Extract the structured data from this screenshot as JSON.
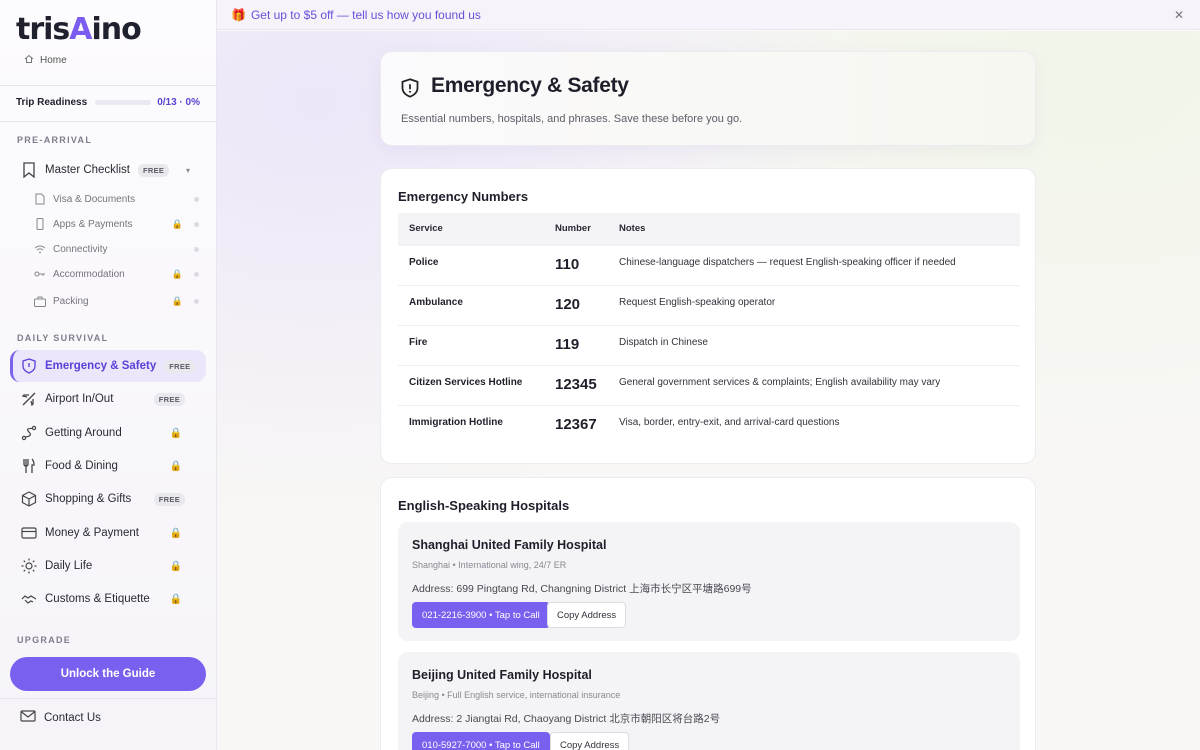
{
  "brand": {
    "logo_left": "tris",
    "logo_accent": "A",
    "logo_right": "ino"
  },
  "sidebar": {
    "home_label": "Home",
    "readiness": {
      "label": "Trip Readiness",
      "value": "0/13 · 0%",
      "progress": 0
    },
    "sections": {
      "pre_arrival": "PRE-ARRIVAL",
      "daily_survival": "DAILY SURVIVAL",
      "upgrade": "UPGRADE"
    },
    "master_checklist": {
      "label": "Master Checklist",
      "badge": "FREE"
    },
    "checklist_items": [
      {
        "label": "Visa & Documents",
        "icon": "document-icon",
        "locked": false
      },
      {
        "label": "Apps & Payments",
        "icon": "phone-icon",
        "locked": true
      },
      {
        "label": "Connectivity",
        "icon": "wifi-icon",
        "locked": false
      },
      {
        "label": "Accommodation",
        "icon": "key-icon",
        "locked": true
      },
      {
        "label": "Packing",
        "icon": "suitcase-icon",
        "locked": true
      }
    ],
    "nav_items": [
      {
        "label": "Emergency & Safety",
        "badge": "FREE",
        "icon": "shield-icon",
        "active": true
      },
      {
        "label": "Airport In/Out",
        "badge": "FREE",
        "icon": "plane-icon"
      },
      {
        "label": "Getting Around",
        "badge": "",
        "icon": "route-icon",
        "locked": true
      },
      {
        "label": "Food & Dining",
        "badge": "",
        "icon": "utensils-icon",
        "locked": true
      },
      {
        "label": "Shopping & Gifts",
        "badge": "FREE",
        "icon": "box-icon"
      },
      {
        "label": "Money & Payment",
        "badge": "",
        "icon": "card-icon",
        "locked": true
      },
      {
        "label": "Daily Life",
        "badge": "",
        "icon": "sun-icon",
        "locked": true
      },
      {
        "label": "Customs & Etiquette",
        "badge": "",
        "icon": "handshake-icon",
        "locked": true
      }
    ],
    "unlock_label": "Unlock the Guide",
    "contact_label": "Contact Us"
  },
  "promo": {
    "text": "Get up to $5 off — tell us how you found us",
    "close": "✕"
  },
  "page": {
    "title": "Emergency & Safety",
    "subtitle": "Essential numbers, hospitals, and phrases. Save these before you go."
  },
  "emergency_numbers": {
    "heading": "Emergency Numbers",
    "columns": [
      "Service",
      "Number",
      "Notes"
    ],
    "rows": [
      {
        "service": "Police",
        "number": "110",
        "notes": "Chinese-language dispatchers — request English-speaking officer if needed"
      },
      {
        "service": "Ambulance",
        "number": "120",
        "notes": "Request English-speaking operator"
      },
      {
        "service": "Fire",
        "number": "119",
        "notes": "Dispatch in Chinese"
      },
      {
        "service": "Citizen Services Hotline",
        "number": "12345",
        "notes": "General government services & complaints; English availability may vary"
      },
      {
        "service": "Immigration Hotline",
        "number": "12367",
        "notes": "Visa, border, entry-exit, and arrival-card questions"
      }
    ]
  },
  "hospitals": {
    "heading": "English-Speaking Hospitals",
    "items": [
      {
        "name": "Shanghai United Family Hospital",
        "meta": "Shanghai • International wing, 24/7 ER",
        "address": "Address: 699 Pingtang Rd, Changning District 上海市长宁区平塘路699号",
        "call": "021-2216-3900 • Tap to Call",
        "copy": "Copy Address"
      },
      {
        "name": "Beijing United Family Hospital",
        "meta": "Beijing • Full English service, international insurance",
        "address": "Address: 2 Jiangtai Rd, Chaoyang District 北京市朝阳区将台路2号",
        "call": "010-5927-7000 • Tap to Call",
        "copy": "Copy Address"
      }
    ]
  },
  "colors": {
    "accent": "#7a60ee",
    "active_bg": "#ece6fb",
    "active_text": "#5b3fd6"
  }
}
